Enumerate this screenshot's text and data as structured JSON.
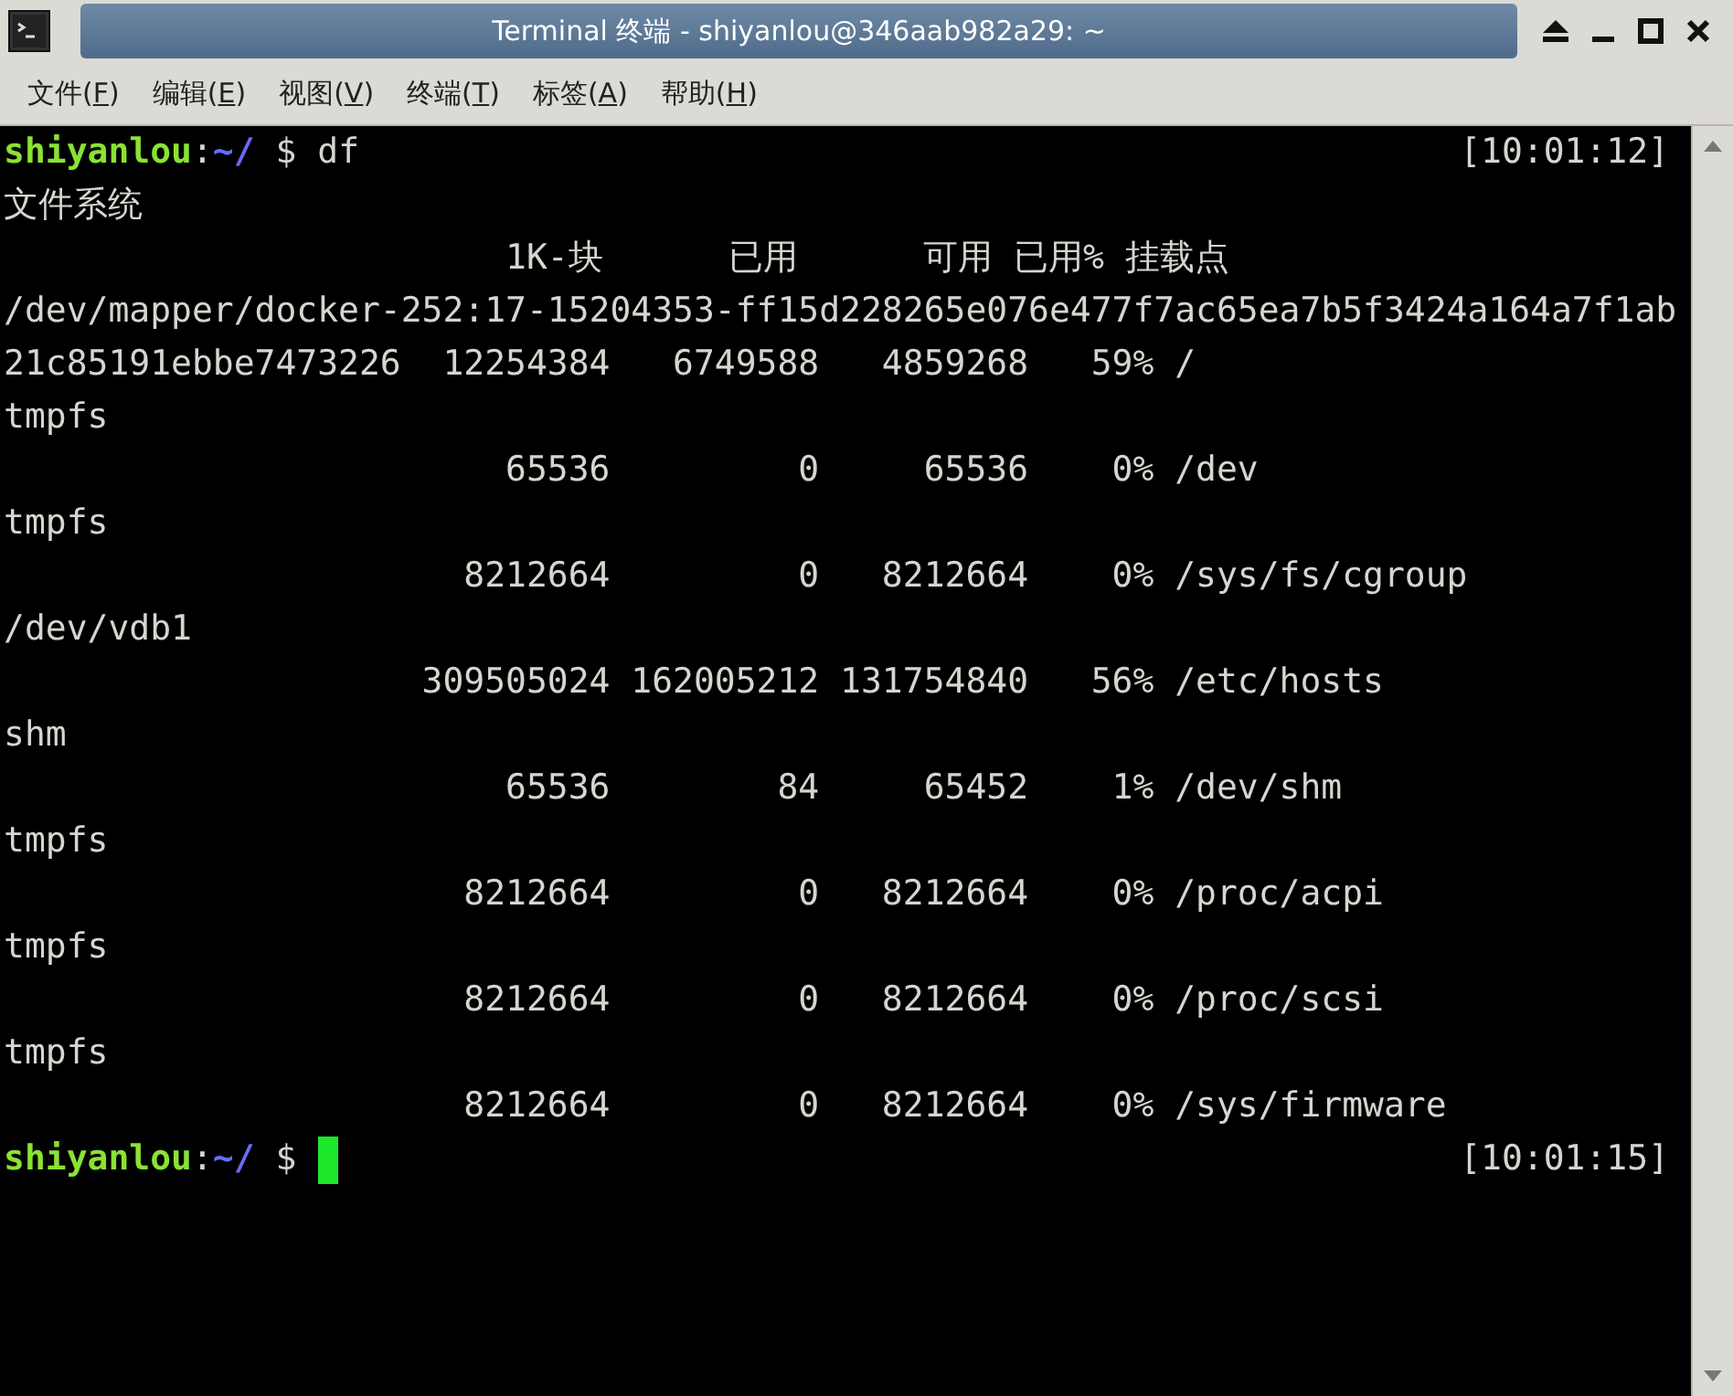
{
  "window": {
    "title": "Terminal 终端 - shiyanlou@346aab982a29: ~"
  },
  "menu": [
    {
      "before": "文件(",
      "key": "F",
      "after": ")"
    },
    {
      "before": "编辑(",
      "key": "E",
      "after": ")"
    },
    {
      "before": "视图(",
      "key": "V",
      "after": ")"
    },
    {
      "before": "终端(",
      "key": "T",
      "after": ")"
    },
    {
      "before": "标签(",
      "key": "A",
      "after": ")"
    },
    {
      "before": "帮助(",
      "key": "H",
      "after": ")"
    }
  ],
  "terminal": {
    "lines": [
      {
        "kind": "prompt",
        "user": "shiyanlou",
        "sep": ":",
        "path": "~/",
        "sigil": " $ ",
        "command": "df",
        "time": "[10:01:12]",
        "cursor": false
      },
      {
        "kind": "output",
        "text": "文件系统"
      },
      {
        "kind": "output",
        "text": "                        1K-块      已用      可用 已用% 挂载点"
      },
      {
        "kind": "output",
        "text": "/dev/mapper/docker-252:17-15204353-ff15d228265e076e477f7ac65ea7b5f3424a164a7f1ab"
      },
      {
        "kind": "output",
        "text": "21c85191ebbe7473226  12254384   6749588   4859268   59% /"
      },
      {
        "kind": "output",
        "text": "tmpfs"
      },
      {
        "kind": "output",
        "text": "                        65536         0     65536    0% /dev"
      },
      {
        "kind": "output",
        "text": "tmpfs"
      },
      {
        "kind": "output",
        "text": "                      8212664         0   8212664    0% /sys/fs/cgroup"
      },
      {
        "kind": "output",
        "text": "/dev/vdb1"
      },
      {
        "kind": "output",
        "text": "                    309505024 162005212 131754840   56% /etc/hosts"
      },
      {
        "kind": "output",
        "text": "shm"
      },
      {
        "kind": "output",
        "text": "                        65536        84     65452    1% /dev/shm"
      },
      {
        "kind": "output",
        "text": "tmpfs"
      },
      {
        "kind": "output",
        "text": "                      8212664         0   8212664    0% /proc/acpi"
      },
      {
        "kind": "output",
        "text": "tmpfs"
      },
      {
        "kind": "output",
        "text": "                      8212664         0   8212664    0% /proc/scsi"
      },
      {
        "kind": "output",
        "text": "tmpfs"
      },
      {
        "kind": "output",
        "text": "                      8212664         0   8212664    0% /sys/firmware"
      },
      {
        "kind": "prompt",
        "user": "shiyanlou",
        "sep": ":",
        "path": "~/",
        "sigil": " $ ",
        "time": "[10:01:15]",
        "cursor": true
      }
    ]
  }
}
